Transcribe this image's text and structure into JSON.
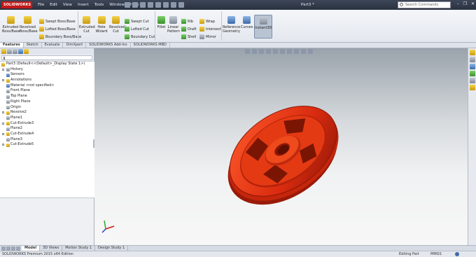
{
  "app": {
    "logo_text": "SOLIDWORKS",
    "window_title": "Part3 *",
    "menu": [
      "File",
      "Edit",
      "View",
      "Insert",
      "Tools",
      "Window",
      "Help"
    ],
    "search_placeholder": "Search Commands"
  },
  "ribbon": {
    "extruded_boss": "Extruded Boss/Base",
    "revolved_boss": "Revolved Boss/Base",
    "swept_boss": "Swept Boss/Base",
    "lofted_boss": "Lofted Boss/Base",
    "boundary_boss": "Boundary Boss/Base",
    "extruded_cut": "Extruded Cut",
    "hole_wizard": "Hole Wizard",
    "revolved_cut": "Revolved Cut",
    "swept_cut": "Swept Cut",
    "lofted_cut": "Lofted Cut",
    "boundary_cut": "Boundary Cut",
    "fillet": "Fillet",
    "linear_pattern": "Linear Pattern",
    "rib": "Rib",
    "draft": "Draft",
    "shell": "Shell",
    "wrap": "Wrap",
    "intersect": "Intersect",
    "mirror": "Mirror",
    "reference_geometry": "Reference Geometry",
    "curves": "Curves",
    "instant3d": "Instant3D"
  },
  "tabs": [
    "Features",
    "Sketch",
    "Evaluate",
    "DimXpert",
    "SOLIDWORKS Add-Ins",
    "SOLIDWORKS MBD"
  ],
  "tree": {
    "root": "Part3  (Default<<Default>_Display State 1>)",
    "items": [
      "History",
      "Sensors",
      "Annotations",
      "Material <not specified>",
      "Front Plane",
      "Top Plane",
      "Right Plane",
      "Origin",
      "Revolve2",
      "Plane1",
      "Cut-Extrude3",
      "Plane2",
      "Cut-Extrude4",
      "Plane3",
      "Cut-Extrude5"
    ]
  },
  "bottom_tabs": [
    "Model",
    "3D Views",
    "Motion Study 1",
    "Design Study 1"
  ],
  "status": {
    "edition": "SOLIDWORKS Premium 2015 x64 Edition",
    "mode": "Editing Part",
    "units": "MMGS"
  },
  "colors": {
    "part_red": "#d92b10",
    "brand_red": "#c01818"
  }
}
